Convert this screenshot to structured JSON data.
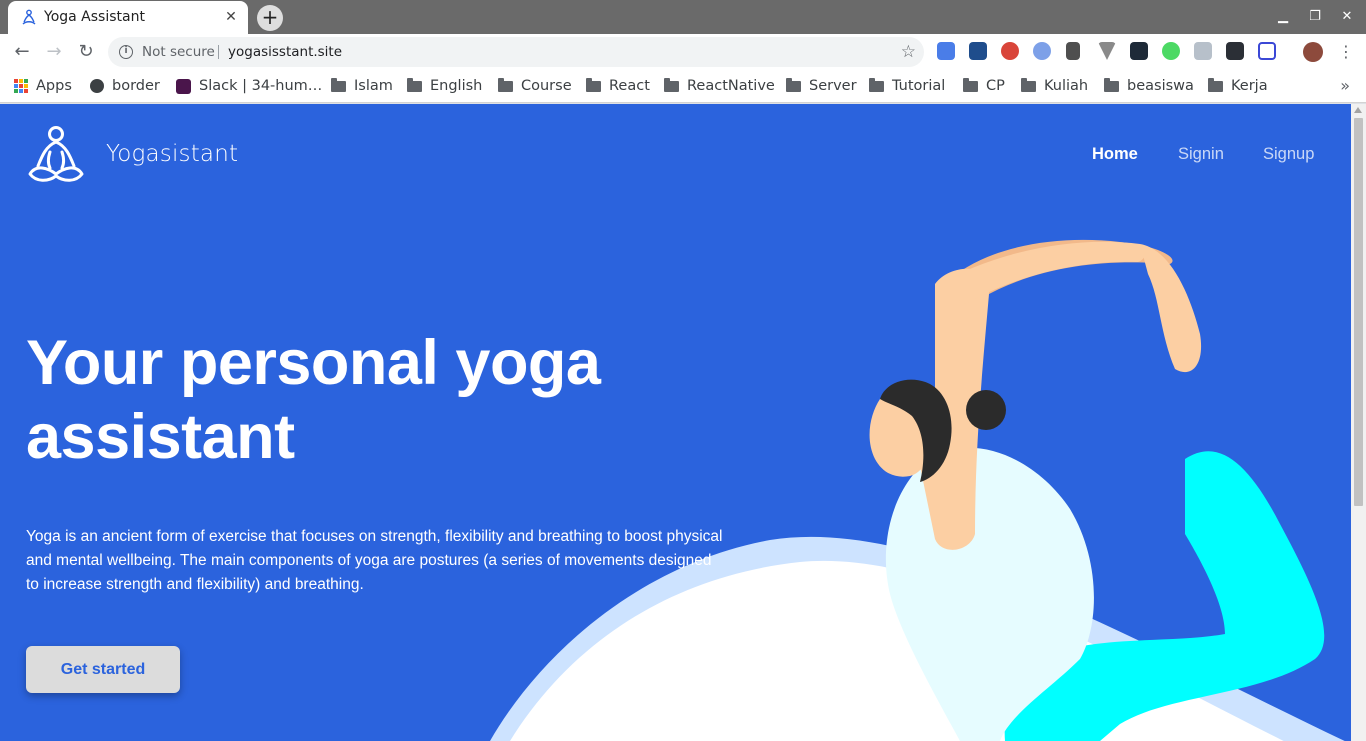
{
  "browser": {
    "tab_title": "Yoga Assistant",
    "tab_close": "✕",
    "new_tab": "+",
    "window_controls": {
      "minimize": "▁",
      "maximize": "❐",
      "close": "✕"
    },
    "security_label": "Not secure",
    "url": "yogasisstant.site",
    "bookmarks": [
      {
        "label": "Apps",
        "icon": "apps-icon"
      },
      {
        "label": "border",
        "icon": "globe-icon"
      },
      {
        "label": "Slack | 34-hum…",
        "icon": "slack-icon"
      },
      {
        "label": "Islam",
        "icon": "folder-icon"
      },
      {
        "label": "English",
        "icon": "folder-icon"
      },
      {
        "label": "Course",
        "icon": "folder-icon"
      },
      {
        "label": "React",
        "icon": "folder-icon"
      },
      {
        "label": "ReactNative",
        "icon": "folder-icon"
      },
      {
        "label": "Server",
        "icon": "folder-icon"
      },
      {
        "label": "Tutorial",
        "icon": "folder-icon"
      },
      {
        "label": "CP",
        "icon": "folder-icon"
      },
      {
        "label": "Kuliah",
        "icon": "folder-icon"
      },
      {
        "label": "beasiswa",
        "icon": "folder-icon"
      },
      {
        "label": "Kerja",
        "icon": "folder-icon"
      }
    ],
    "bookmarks_more": "»"
  },
  "site": {
    "brand": "Yogasistant",
    "nav": {
      "home": "Home",
      "signin": "Signin",
      "signup": "Signup"
    },
    "hero_title": "Your personal yoga assistant",
    "hero_description": "Yoga is an ancient form of exercise that focuses on strength, flexibility and breathing to boost physical and mental wellbeing. The main components of yoga are postures (a series of movements designed to increase strength and flexibility) and breathing.",
    "cta_label": "Get started"
  },
  "colors": {
    "hero_background": "#2b63dd",
    "cta_background": "#dcdcdc",
    "leggings": "#00ffff",
    "skin": "#fccfa3",
    "top": "#e6fcff"
  }
}
